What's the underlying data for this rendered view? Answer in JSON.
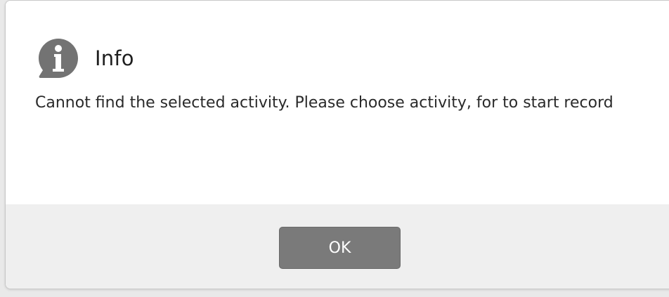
{
  "dialog": {
    "title": "Info",
    "icon": "info-icon",
    "message": "Cannot find the selected activity. Please choose activity, for to start record",
    "ok_label": "OK"
  },
  "colors": {
    "icon_fill": "#737373",
    "button_fill": "#7a7a7a",
    "footer_bg": "#efefef"
  }
}
